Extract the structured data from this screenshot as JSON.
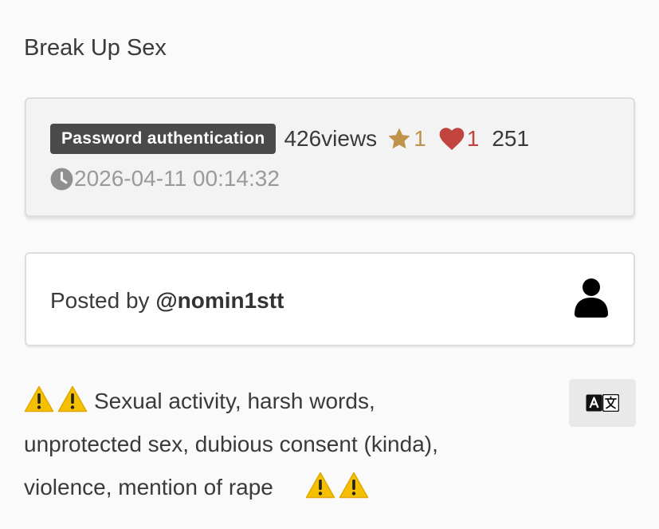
{
  "title": "Break Up Sex",
  "stats": {
    "auth_badge": "Password authentication",
    "views": "426views",
    "star_count": "1",
    "heart_count": "1",
    "extra_count": "251",
    "date": "2026-04-11 00:14:32"
  },
  "author": {
    "prefix": "Posted by ",
    "handle": "@nomin1stt"
  },
  "description": {
    "line1": "Sexual activity, harsh words,",
    "line2": "unprotected sex, dubious consent (kinda),",
    "line3": "violence, mention of rape"
  },
  "icons": {
    "star": "star-icon",
    "heart": "heart-icon",
    "clock": "clock-icon",
    "user": "user-icon",
    "warning": "warning-icon",
    "translate": "translate-icon"
  },
  "colors": {
    "badge_bg": "#4a4a4a",
    "star": "#c0924b",
    "heart": "#c2443f",
    "muted": "#9a9a9a",
    "warning": "#f5c000"
  }
}
